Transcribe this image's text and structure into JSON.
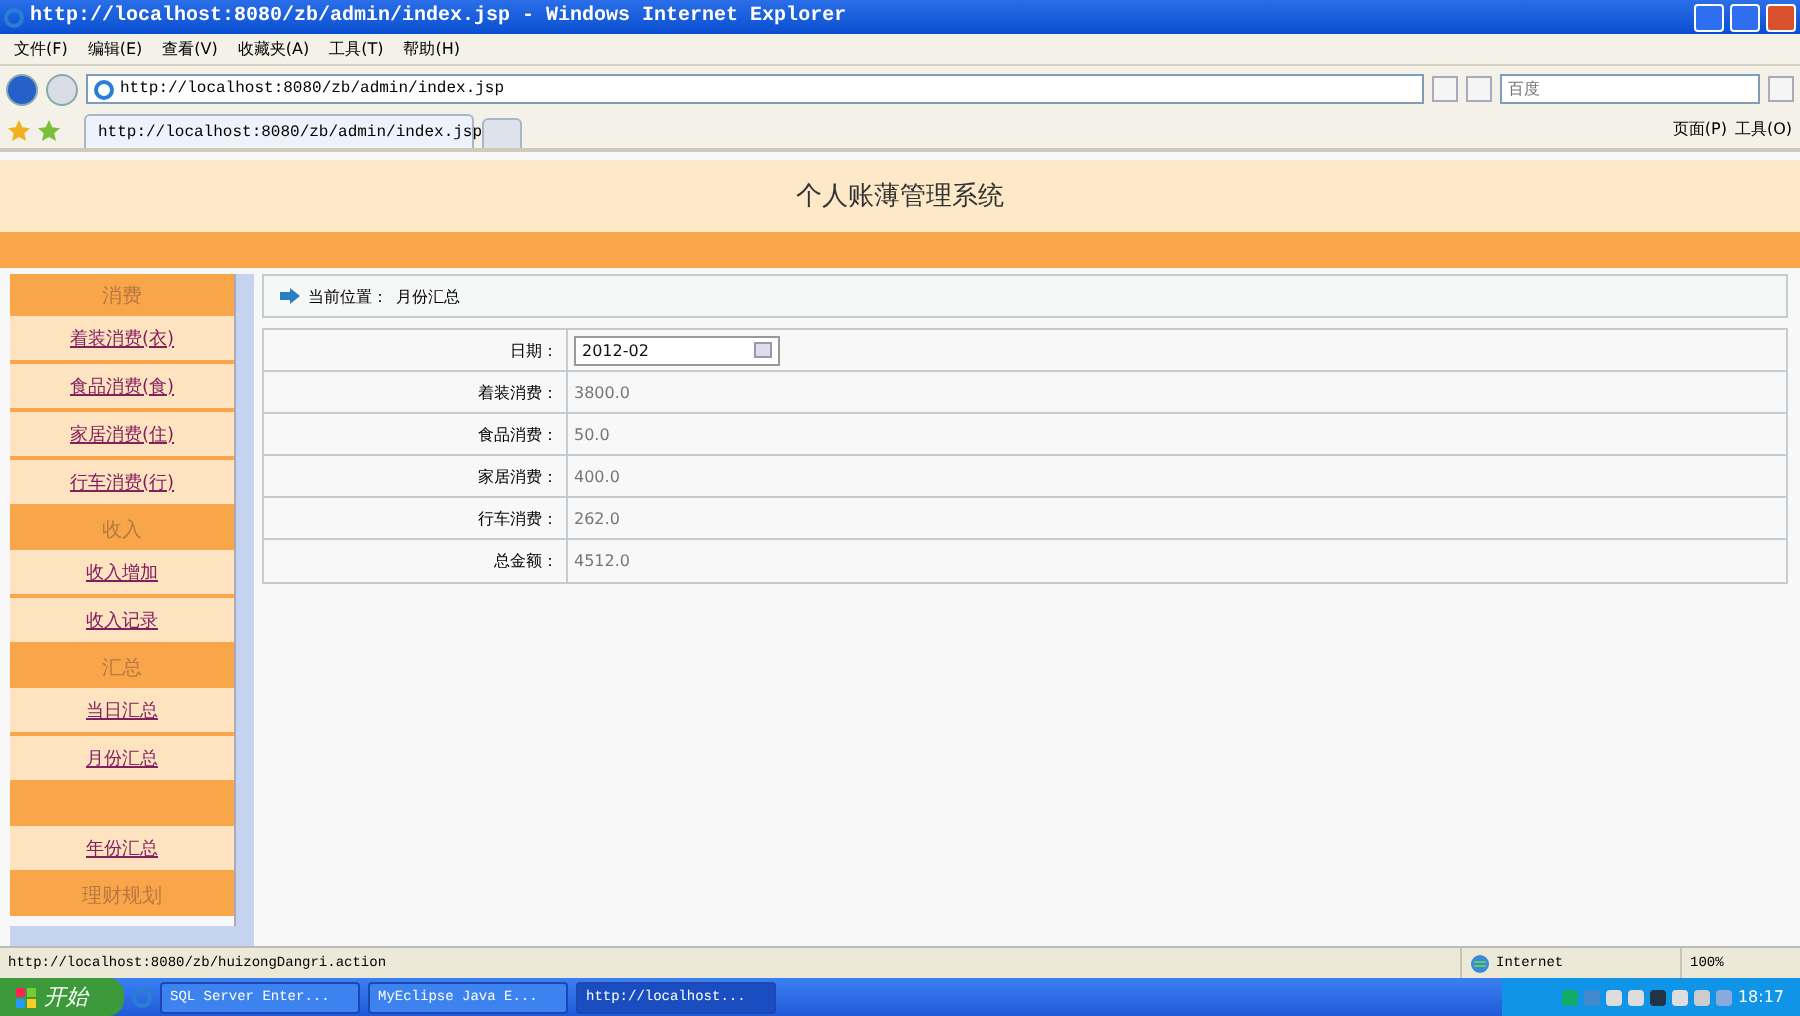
{
  "window": {
    "title": "http://localhost:8080/zb/admin/index.jsp - Windows Internet Explorer"
  },
  "menu": [
    "文件(F)",
    "编辑(E)",
    "查看(V)",
    "收藏夹(A)",
    "工具(T)",
    "帮助(H)"
  ],
  "address": {
    "value": "http://localhost:8080/zb/admin/index.jsp"
  },
  "search": {
    "placeholder": "百度"
  },
  "tab": {
    "label": "http://localhost:8080/zb/admin/index.jsp",
    "selected": true
  },
  "command_bar": [
    "页面(P)",
    "工具(O)"
  ],
  "page": {
    "title": "个人账薄管理系统",
    "sidebar": [
      {
        "title": "消费",
        "links": [
          "着装消费(衣)",
          "食品消费(食)",
          "家居消费(住)",
          "行车消费(行)"
        ]
      },
      {
        "title": "收入",
        "links": [
          "收入增加",
          "收入记录"
        ]
      },
      {
        "title": "汇总",
        "links": [
          "当日汇总",
          "月份汇总"
        ]
      },
      {
        "links": [
          "年份汇总"
        ]
      },
      {
        "title": "理财规划"
      }
    ],
    "breadcrumb": {
      "label": "当前位置：",
      "value": "月份汇总"
    },
    "date": {
      "label": "日期：",
      "value": "2012-02"
    },
    "rows": [
      {
        "label": "着装消费：",
        "value": "3800.0"
      },
      {
        "label": "食品消费：",
        "value": "50.0"
      },
      {
        "label": "家居消费：",
        "value": "400.0"
      },
      {
        "label": "行车消费：",
        "value": "262.0"
      },
      {
        "label": "总金额：",
        "value": "4512.0"
      }
    ]
  },
  "status_bar": {
    "url": "http://localhost:8080/zb/huizongDangri.action",
    "zone": "Internet",
    "zoom": "100%"
  },
  "taskbar": {
    "start": "开始",
    "tasks": [
      {
        "label": "SQL Server Enter...",
        "selected": false
      },
      {
        "label": "MyEclipse Java E...",
        "selected": false
      },
      {
        "label": "http://localhost...",
        "selected": true
      }
    ],
    "clock": "18:17"
  }
}
